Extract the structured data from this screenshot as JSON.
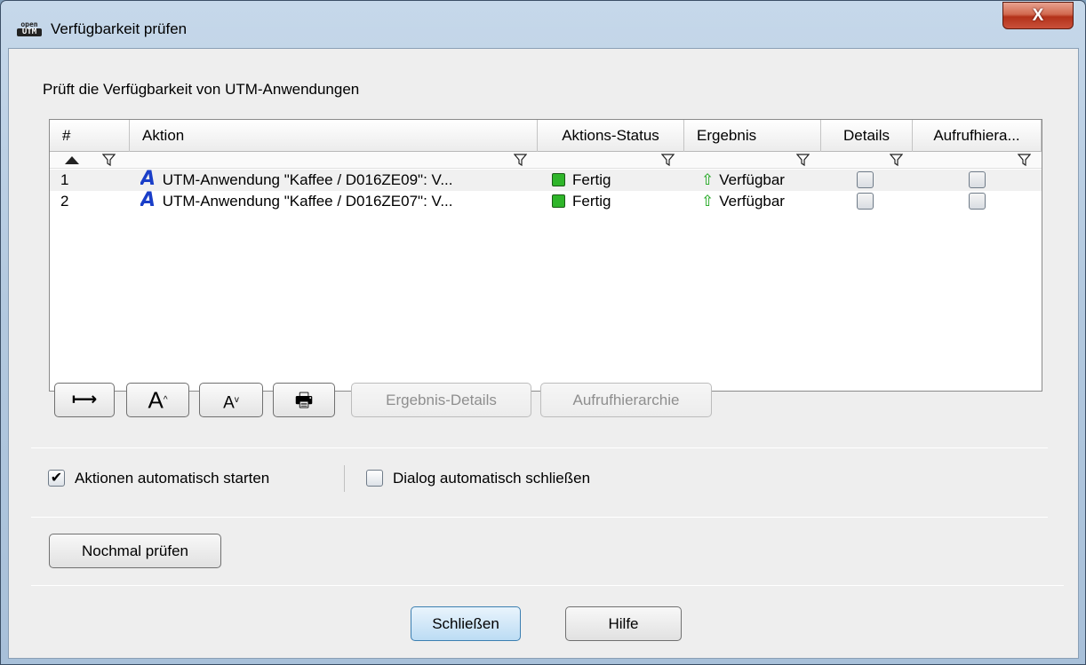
{
  "window": {
    "title": "Verfügbarkeit prüfen",
    "icon_top": "open",
    "icon_bottom": "UTM",
    "close_symbol": "X"
  },
  "description": "Prüft die Verfügbarkeit von UTM-Anwendungen",
  "table": {
    "columns": [
      "#",
      "Aktion",
      "Aktions-Status",
      "Ergebnis",
      "Details",
      "Aufrufhiera..."
    ],
    "rows": [
      {
        "num": "1",
        "action": "UTM-Anwendung \"Kaffee / D016ZE09\": V...",
        "status": "Fertig",
        "result": "Verfügbar",
        "details": false,
        "call_hierarchy": false
      },
      {
        "num": "2",
        "action": "UTM-Anwendung \"Kaffee / D016ZE07\": V...",
        "status": "Fertig",
        "result": "Verfügbar",
        "details": false,
        "call_hierarchy": false
      }
    ],
    "status_color": "#2fb52a",
    "result_icon": "up-arrow-icon",
    "result_icon_glyph": "⇧",
    "action_icon_glyph": "A"
  },
  "toolbar": {
    "fit_columns_glyph": "⟼",
    "font_larger_glyph": "A",
    "font_smaller_glyph": "A",
    "print_glyph": "🖶",
    "result_details_label": "Ergebnis-Details",
    "call_hierarchy_label": "Aufrufhierarchie"
  },
  "options": {
    "auto_start_label": "Aktionen automatisch starten",
    "auto_start_checked": true,
    "auto_close_label": "Dialog automatisch schließen",
    "auto_close_checked": false
  },
  "buttons": {
    "recheck": "Nochmal prüfen",
    "close": "Schließen",
    "help": "Hilfe"
  }
}
